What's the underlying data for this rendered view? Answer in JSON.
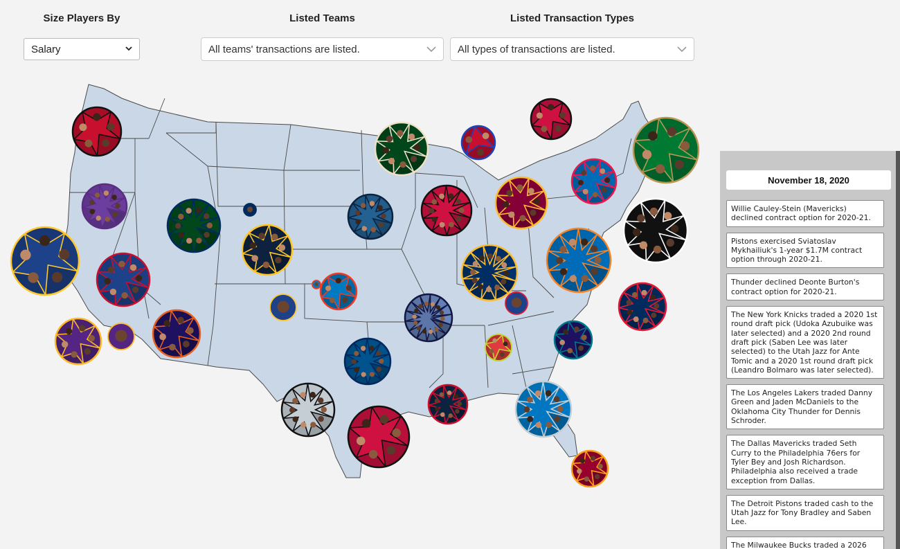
{
  "controls": {
    "size_label": "Size Players By",
    "size_value": "Salary",
    "teams_label": "Listed Teams",
    "teams_value": "All teams' transactions are listed.",
    "types_label": "Listed Transaction Types",
    "types_value": "All types of transactions are listed."
  },
  "colors": {
    "background": "#f3f3f3",
    "map_fill": "#c9d7e6",
    "state_border": "#4a4a4a",
    "sidebar_bg": "#c8c8c8"
  },
  "map": {
    "teams": [
      {
        "id": "portland",
        "ring": "#111111",
        "fill": "#c8102e",
        "cells": 5
      },
      {
        "id": "sacramento",
        "ring": "#5a2d81",
        "fill": "#6c3ea0",
        "cells": 9
      },
      {
        "id": "golden-state",
        "ring": "#ffc72c",
        "fill": "#1d428a",
        "cells": 5
      },
      {
        "id": "la-clippers",
        "ring": "#c8102e",
        "fill": "#1d428a",
        "cells": 8
      },
      {
        "id": "la-lakers",
        "ring": "#fdb927",
        "fill": "#552583",
        "cells": 6
      },
      {
        "id": "la-lakers-small",
        "ring": "#fdb927",
        "fill": "#552583",
        "cells": 1
      },
      {
        "id": "phoenix",
        "ring": "#e56020",
        "fill": "#1d1160",
        "cells": 6
      },
      {
        "id": "utah",
        "ring": "#002b5c",
        "fill": "#00471b",
        "cells": 10
      },
      {
        "id": "utah-small",
        "ring": "#002b5c",
        "fill": "#002b5c",
        "cells": 1
      },
      {
        "id": "denver",
        "ring": "#fec524",
        "fill": "#0e2240",
        "cells": 7
      },
      {
        "id": "minnesota",
        "ring": "#0c2340",
        "fill": "#236192",
        "cells": 9
      },
      {
        "id": "milwaukee",
        "ring": "#eee1c6",
        "fill": "#00471b",
        "cells": 8
      },
      {
        "id": "detroit-small",
        "ring": "#1d42ba",
        "fill": "#c8102e",
        "cells": 3
      },
      {
        "id": "toronto",
        "ring": "#111111",
        "fill": "#ce1141",
        "cells": 5
      },
      {
        "id": "boston",
        "ring": "#ba9653",
        "fill": "#007a33",
        "cells": 6
      },
      {
        "id": "chicago",
        "ring": "#111111",
        "fill": "#ce1141",
        "cells": 10
      },
      {
        "id": "cleveland",
        "ring": "#fdbb30",
        "fill": "#860038",
        "cells": 8
      },
      {
        "id": "new-york",
        "ring": "#f58426",
        "fill": "#006bb6",
        "cells": 10
      },
      {
        "id": "brooklyn",
        "ring": "#ffffff",
        "fill": "#111111",
        "cells": 8
      },
      {
        "id": "philadelphia",
        "ring": "#ed174c",
        "fill": "#006bb6",
        "cells": 8
      },
      {
        "id": "indiana",
        "ring": "#fdbb30",
        "fill": "#002d62",
        "cells": 12
      },
      {
        "id": "washington",
        "ring": "#e31837",
        "fill": "#002b5c",
        "cells": 9
      },
      {
        "id": "memphis",
        "ring": "#12173f",
        "fill": "#5d76a9",
        "cells": 14
      },
      {
        "id": "atlanta",
        "ring": "#c1d32f",
        "fill": "#e03a3e",
        "cells": 4
      },
      {
        "id": "charlotte",
        "ring": "#00788c",
        "fill": "#1d1160",
        "cells": 6
      },
      {
        "id": "orlando",
        "ring": "#c4ced4",
        "fill": "#0077c0",
        "cells": 10
      },
      {
        "id": "miami",
        "ring": "#f9a01b",
        "fill": "#98002e",
        "cells": 6
      },
      {
        "id": "new-orleans",
        "ring": "#c8102e",
        "fill": "#0c2340",
        "cells": 9
      },
      {
        "id": "houston",
        "ring": "#111111",
        "fill": "#ce1141",
        "cells": 6
      },
      {
        "id": "san-antonio",
        "ring": "#111111",
        "fill": "#c4ced4",
        "cells": 10
      },
      {
        "id": "dallas",
        "ring": "#00285e",
        "fill": "#00538c",
        "cells": 10
      },
      {
        "id": "okc",
        "ring": "#ef3b24",
        "fill": "#007ac1",
        "cells": 5
      },
      {
        "id": "okc-small",
        "ring": "#ef3b24",
        "fill": "#007ac1",
        "cells": 1
      },
      {
        "id": "gs-small",
        "ring": "#ffc72c",
        "fill": "#1d428a",
        "cells": 1
      },
      {
        "id": "tn-small",
        "ring": "#e31837",
        "fill": "#1d428a",
        "cells": 1
      }
    ]
  },
  "sidebar": {
    "date": "November 18, 2020",
    "transactions": [
      "Willie Cauley-Stein (Mavericks) declined contract option for 2020-21.",
      "Pistons exercised Sviatoslav Mykhailiuk's 1-year $1.7M contract option through 2020-21.",
      "Thunder declined Deonte Burton's contract option for 2020-21.",
      "The New York Knicks traded a 2020 1st round draft pick (Udoka Azubuike was later selected) and a 2020 2nd round draft pick (Saben Lee was later selected) to the Utah Jazz for Ante Tomic and a 2020 1st round draft pick (Leandro Bolmaro was later selected).",
      "The Los Angeles Lakers traded Danny Green and Jaden McDaniels to the Oklahoma City Thunder for Dennis Schroder.",
      "The Dallas Mavericks traded Seth Curry to the Philadelphia 76ers for Tyler Bey and Josh Richardson. Philadelphia also received a trade exception from Dallas.",
      "The Detroit Pistons traded cash to the Utah Jazz for Tony Bradley and Saben Lee.",
      "The Milwaukee Bucks traded a 2026"
    ]
  }
}
